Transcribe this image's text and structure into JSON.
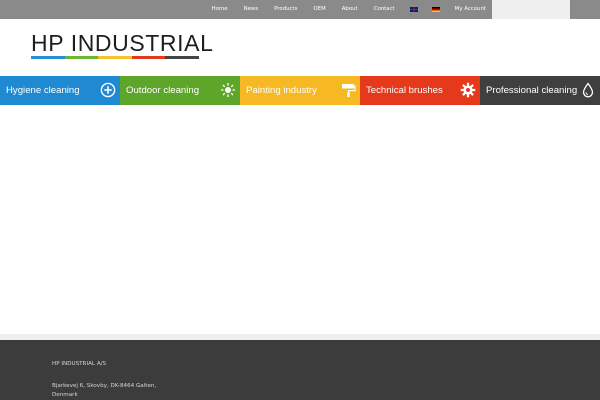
{
  "topnav": {
    "items": [
      "Home",
      "News",
      "Products",
      "OEM",
      "About",
      "Contact"
    ],
    "flags": [
      "uk-flag-icon",
      "de-flag-icon"
    ],
    "account": "My Account"
  },
  "logo": {
    "text": "HP INDUSTRIAL",
    "stripe_colors": [
      "#2b8fd3",
      "#6fb533",
      "#f5c233",
      "#e23a1c",
      "#444444"
    ]
  },
  "categories": [
    {
      "label": "Hygiene cleaning",
      "color": "#1f8ad2",
      "icon": "plus-circle-icon"
    },
    {
      "label": "Outdoor cleaning",
      "color": "#5da62a",
      "icon": "sun-icon"
    },
    {
      "label": "Painting industry",
      "color": "#f6b923",
      "icon": "paint-roller-icon"
    },
    {
      "label": "Technical brushes",
      "color": "#e5391b",
      "icon": "gear-icon"
    },
    {
      "label": "Professional cleaning",
      "color": "#3f3f3f",
      "icon": "water-drop-icon"
    }
  ],
  "footer": {
    "company": "HP INDUSTRIAL A/S",
    "address_line1": "Bjarkevej 6, Skovby, DK-8464 Galten,",
    "address_line2": "Denmark"
  }
}
